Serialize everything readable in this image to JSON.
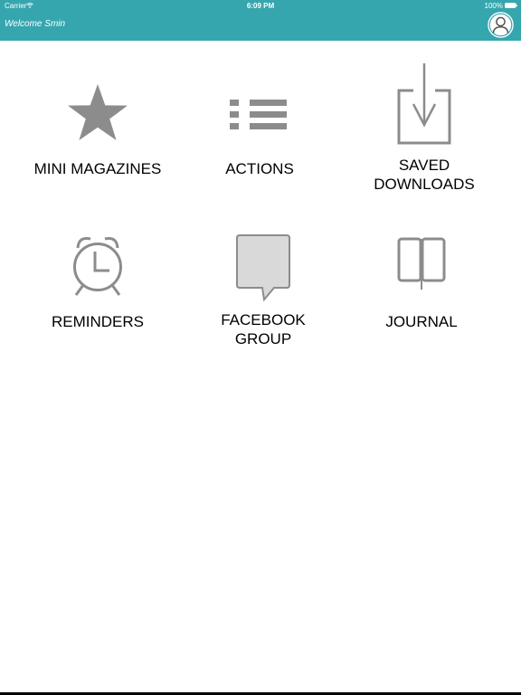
{
  "status_bar": {
    "carrier": "Carrier",
    "time": "6:09 PM",
    "battery": "100%"
  },
  "header": {
    "welcome": "Welcome Smin",
    "avatar_icon": "user-avatar-icon"
  },
  "colors": {
    "header_bg": "#36a6ae",
    "icon_gray": "#8c8c8c",
    "bubble_fill": "#d9d9d9"
  },
  "menu": {
    "items": [
      {
        "label": "MINI MAGAZINES",
        "icon": "star-icon"
      },
      {
        "label": "ACTIONS",
        "icon": "list-icon"
      },
      {
        "label": "SAVED\nDOWNLOADS",
        "icon": "download-icon"
      },
      {
        "label": "REMINDERS",
        "icon": "alarm-clock-icon"
      },
      {
        "label": "FACEBOOK\nGROUP",
        "icon": "speech-bubble-icon"
      },
      {
        "label": "JOURNAL",
        "icon": "book-icon"
      }
    ]
  }
}
